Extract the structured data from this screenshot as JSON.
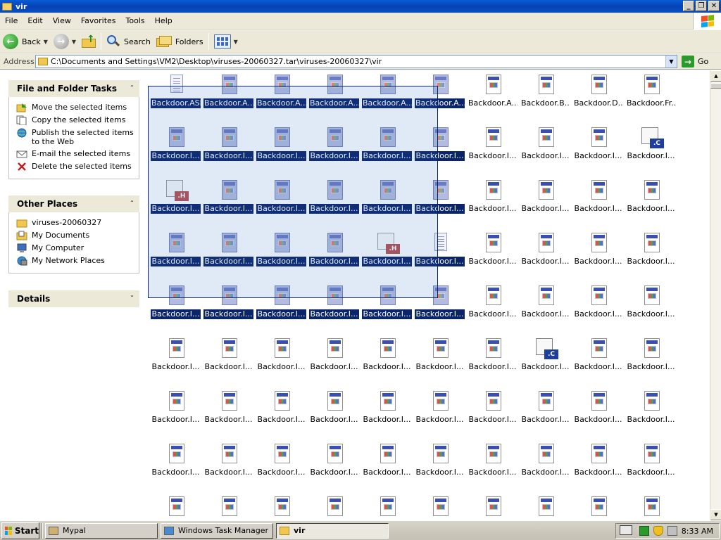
{
  "window": {
    "title": "vir",
    "minimize": "_",
    "maximize": "❐",
    "close": "✕"
  },
  "menu": [
    "File",
    "Edit",
    "View",
    "Favorites",
    "Tools",
    "Help"
  ],
  "toolbar": {
    "back": "Back",
    "search": "Search",
    "folders": "Folders"
  },
  "address": {
    "label": "Address",
    "path": "C:\\Documents and Settings\\VM2\\Desktop\\viruses-20060327.tar\\viruses-20060327\\vir",
    "go": "Go"
  },
  "left_pane": {
    "file_tasks": {
      "title": "File and Folder Tasks",
      "items": [
        "Move the selected items",
        "Copy the selected items",
        "Publish the selected items to the Web",
        "E-mail the selected items",
        "Delete the selected items"
      ]
    },
    "other_places": {
      "title": "Other Places",
      "items": [
        "viruses-20060327",
        "My Documents",
        "My Computer",
        "My Network Places"
      ]
    },
    "details": {
      "title": "Details"
    }
  },
  "files": {
    "rows": [
      [
        "Backdoor.ASP",
        "Backdoor.A...",
        "Backdoor.A...",
        "Backdoor.A...",
        "Backdoor.A...",
        "Backdoor.A...",
        "Backdoor.A...",
        "Backdoor.B...",
        "Backdoor.D...",
        "Backdoor.Fr..."
      ],
      [
        "Backdoor.I...",
        "Backdoor.I...",
        "Backdoor.I...",
        "Backdoor.I...",
        "Backdoor.I...",
        "Backdoor.I...",
        "Backdoor.I...",
        "Backdoor.I...",
        "Backdoor.I...",
        "Backdoor.I..."
      ],
      [
        "Backdoor.I...",
        "Backdoor.I...",
        "Backdoor.I...",
        "Backdoor.I...",
        "Backdoor.I...",
        "Backdoor.I...",
        "Backdoor.I...",
        "Backdoor.I...",
        "Backdoor.I...",
        "Backdoor.I..."
      ],
      [
        "Backdoor.I...",
        "Backdoor.I...",
        "Backdoor.I...",
        "Backdoor.I...",
        "Backdoor.I...",
        "Backdoor.I...",
        "Backdoor.I...",
        "Backdoor.I...",
        "Backdoor.I...",
        "Backdoor.I..."
      ],
      [
        "Backdoor.I...",
        "Backdoor.I...",
        "Backdoor.I...",
        "Backdoor.I...",
        "Backdoor.I...",
        "Backdoor.I...",
        "Backdoor.I...",
        "Backdoor.I...",
        "Backdoor.I...",
        "Backdoor.I..."
      ],
      [
        "Backdoor.I...",
        "Backdoor.I...",
        "Backdoor.I...",
        "Backdoor.I...",
        "Backdoor.I...",
        "Backdoor.I...",
        "Backdoor.I...",
        "Backdoor.I...",
        "Backdoor.I...",
        "Backdoor.I..."
      ],
      [
        "Backdoor.I...",
        "Backdoor.I...",
        "Backdoor.I...",
        "Backdoor.I...",
        "Backdoor.I...",
        "Backdoor.I...",
        "Backdoor.I...",
        "Backdoor.I...",
        "Backdoor.I...",
        "Backdoor.I..."
      ],
      [
        "Backdoor.I...",
        "Backdoor.I...",
        "Backdoor.I...",
        "Backdoor.I...",
        "Backdoor.I...",
        "Backdoor.I...",
        "Backdoor.I...",
        "Backdoor.I...",
        "Backdoor.I...",
        "Backdoor.I..."
      ],
      [
        "",
        "",
        "",
        "",
        "",
        "",
        "",
        "",
        "",
        ""
      ]
    ],
    "icon_types": {
      "0,0": "text",
      "1,9": "c",
      "2,0": "h",
      "3,4": "h",
      "3,5": "text",
      "5,7": "c"
    },
    "selected_rows": [
      0,
      1,
      2,
      3,
      4
    ],
    "selected_cols": [
      0,
      1,
      2,
      3,
      4,
      5
    ]
  },
  "taskbar": {
    "start": "Start",
    "tasks": [
      {
        "label": "Mypal",
        "active": false
      },
      {
        "label": "Windows Task Manager",
        "active": false
      },
      {
        "label": "vir",
        "active": true
      }
    ],
    "clock": "8:33 AM"
  },
  "colors": {
    "selection": "#0a246a",
    "title_bar": "#0643b5",
    "xp_blue_panel": "#215dc6"
  }
}
